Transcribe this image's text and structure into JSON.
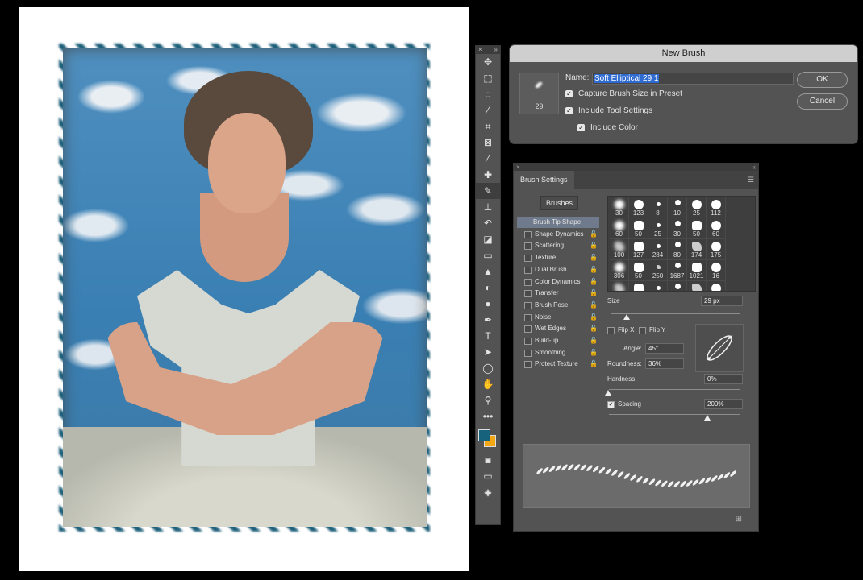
{
  "new_brush_dialog": {
    "title": "New Brush",
    "name_label": "Name:",
    "name_value": "Soft Elliptical 29 1",
    "preview_size": "29",
    "capture_size_label": "Capture Brush Size in Preset",
    "capture_size_checked": true,
    "include_tool_label": "Include Tool Settings",
    "include_tool_checked": true,
    "include_color_label": "Include Color",
    "include_color_checked": true,
    "ok_label": "OK",
    "cancel_label": "Cancel"
  },
  "toolbar": {
    "foreground_color": "#16617c",
    "background_color": "#f2a713",
    "tools": [
      "move-icon",
      "marquee-icon",
      "lasso-icon",
      "magic-wand-icon",
      "crop-icon",
      "frame-icon",
      "eyedropper-icon",
      "healing-icon",
      "brush-icon",
      "stamp-icon",
      "history-brush-icon",
      "eraser-icon",
      "gradient-icon",
      "blur-icon",
      "dodge-icon",
      "smudge-icon",
      "zoom-icon",
      "pen-icon",
      "type-icon",
      "path-select-icon",
      "ellipse-icon",
      "hand-icon",
      "zoom-tool-icon",
      "more-tools-icon"
    ],
    "active_tool": "brush-icon"
  },
  "brush_settings": {
    "tab_label": "Brush Settings",
    "brushes_button": "Brushes",
    "options": [
      {
        "label": "Brush Tip Shape",
        "selected": true
      },
      {
        "label": "Shape Dynamics"
      },
      {
        "label": "Scattering"
      },
      {
        "label": "Texture"
      },
      {
        "label": "Dual Brush"
      },
      {
        "label": "Color Dynamics"
      },
      {
        "label": "Transfer"
      },
      {
        "label": "Brush Pose"
      },
      {
        "label": "Noise"
      },
      {
        "label": "Wet Edges"
      },
      {
        "label": "Build-up"
      },
      {
        "label": "Smoothing"
      },
      {
        "label": "Protect Texture"
      }
    ],
    "tips": [
      "30",
      "123",
      "8",
      "10",
      "25",
      "112",
      "60",
      "50",
      "25",
      "30",
      "50",
      "60",
      "100",
      "127",
      "284",
      "80",
      "174",
      "175",
      "306",
      "50",
      "250",
      "1687",
      "1021",
      "16",
      "",
      "",
      "",
      "",
      "",
      ""
    ],
    "size_label": "Size",
    "size_value": "29 px",
    "flip_x_label": "Flip X",
    "flip_y_label": "Flip Y",
    "angle_label": "Angle:",
    "angle_value": "45°",
    "roundness_label": "Roundness:",
    "roundness_value": "36%",
    "hardness_label": "Hardness",
    "hardness_value": "0%",
    "spacing_label": "Spacing",
    "spacing_value": "200%",
    "spacing_checked": true
  }
}
